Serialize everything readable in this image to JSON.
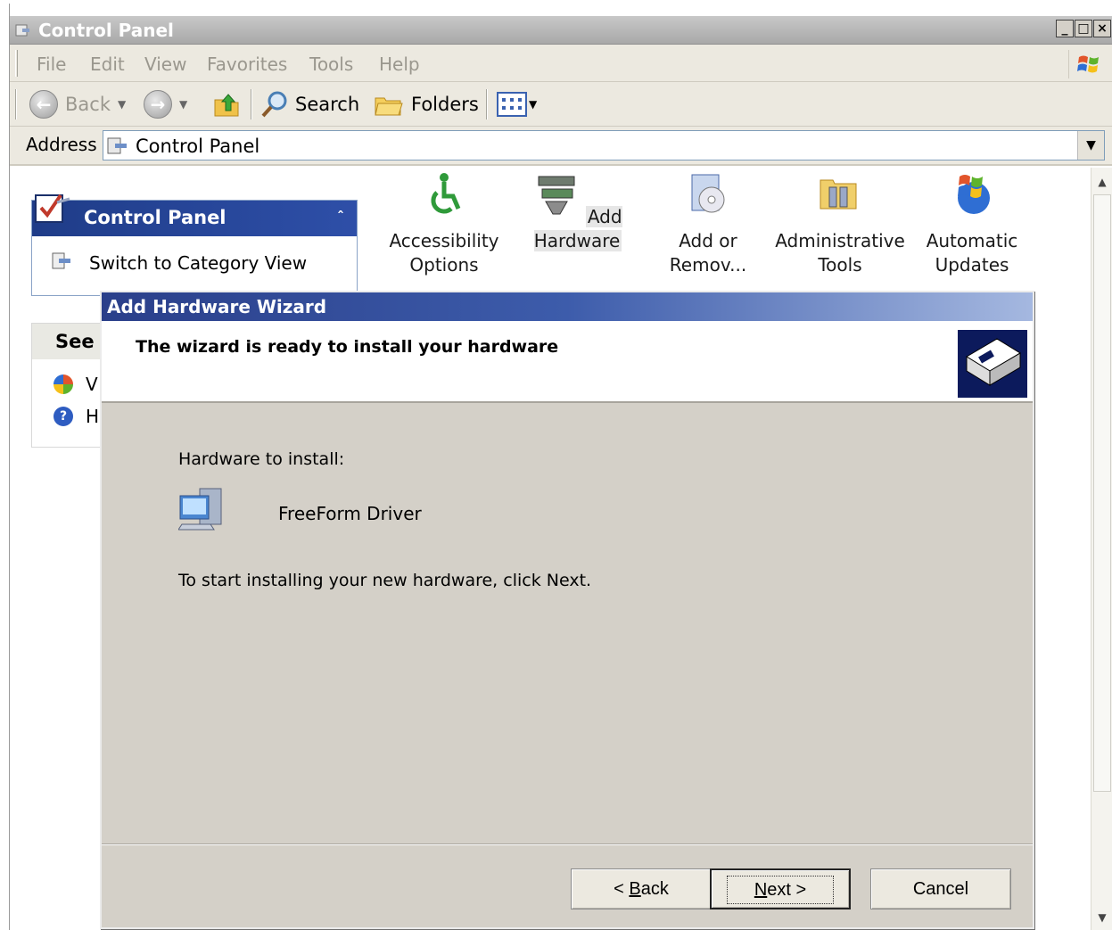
{
  "window": {
    "title": "Control Panel",
    "caption_buttons": [
      "_",
      "□",
      "×"
    ]
  },
  "menu": [
    "File",
    "Edit",
    "View",
    "Favorites",
    "Tools",
    "Help"
  ],
  "toolbar": {
    "back_label": "Back",
    "search_label": "Search",
    "folders_label": "Folders"
  },
  "address": {
    "label": "Address",
    "value": "Control Panel"
  },
  "task_pane": {
    "title": "Control Panel",
    "switch_link": "Switch to Category View",
    "see_also_title": "See /",
    "see_also_items": [
      "V",
      "H"
    ]
  },
  "applets": [
    {
      "line1": "Accessibility",
      "line2": "Options"
    },
    {
      "line1": "Add Hardware",
      "line2": ""
    },
    {
      "line1": "Add or",
      "line2": "Remov..."
    },
    {
      "line1": "Administrative",
      "line2": "Tools"
    },
    {
      "line1": "Automatic",
      "line2": "Updates"
    }
  ],
  "wizard": {
    "title": "Add Hardware Wizard",
    "heading": "The wizard is ready to install your hardware",
    "hardware_label": "Hardware to install:",
    "hardware_name": "FreeForm Driver",
    "hint": "To start installing your new hardware, click Next.",
    "buttons": {
      "back": {
        "prefix": "< ",
        "key": "B",
        "rest": "ack"
      },
      "next": {
        "key": "N",
        "rest": "ext >"
      },
      "cancel": "Cancel"
    }
  },
  "colors": {
    "wizard_title": "#2a3f8a",
    "dialog_face": "#d4d0c8",
    "task_pane_header": "#1f3c88"
  }
}
